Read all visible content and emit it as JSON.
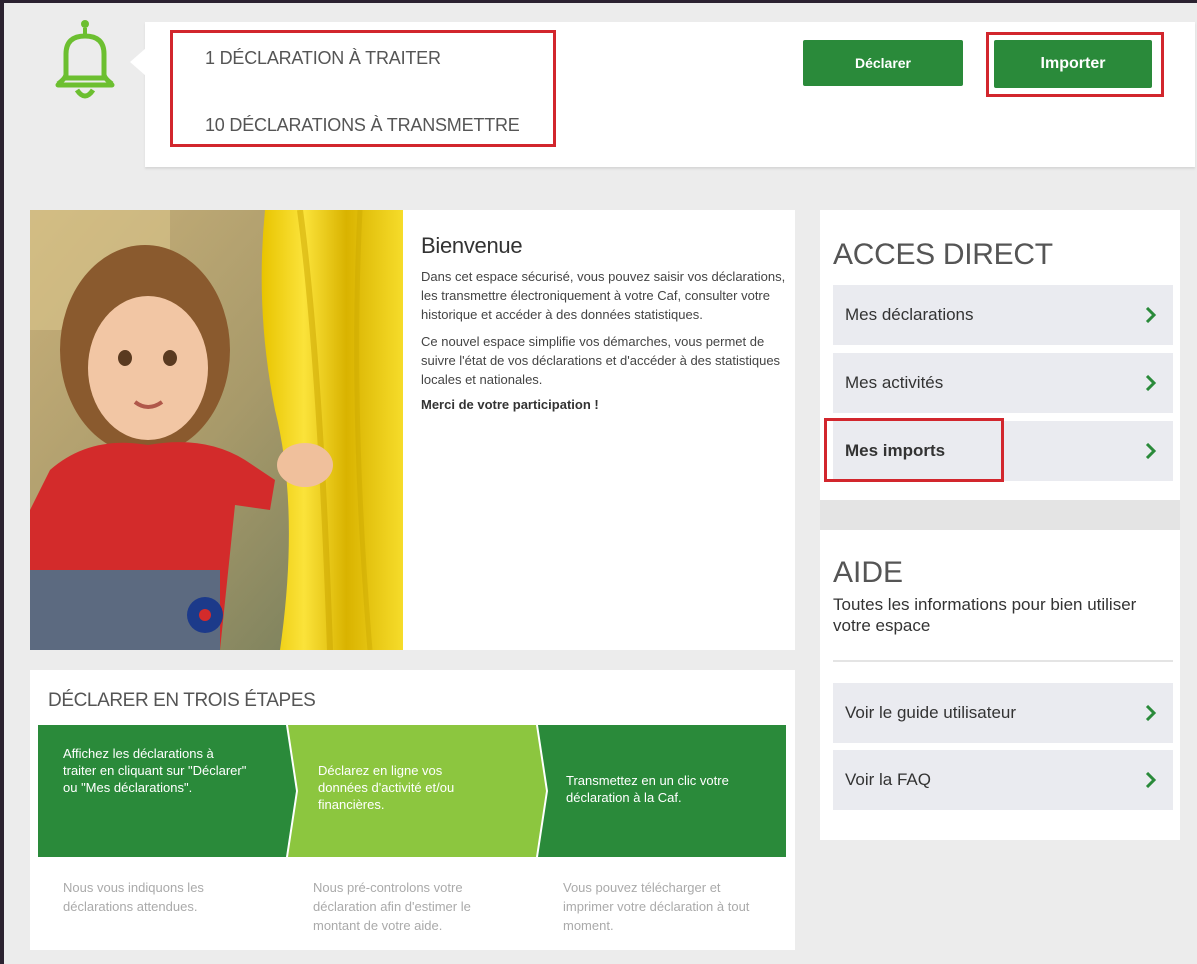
{
  "notifications": {
    "line1": "1 DÉCLARATION À TRAITER",
    "line2": "10 DÉCLARATIONS À TRANSMETTRE"
  },
  "toolbar": {
    "declarer_label": "Déclarer",
    "importer_label": "Importer"
  },
  "welcome": {
    "title": "Bienvenue",
    "paragraph1": "Dans cet espace sécurisé, vous pouvez saisir vos déclarations, les transmettre électroniquement à votre Caf, consulter votre historique et accéder à des données statistiques.",
    "paragraph2": "Ce nouvel espace simplifie vos démarches, vous permet de suivre l'état de vos déclarations et d'accéder à des statistiques locales et nationales.",
    "thanks": "Merci de votre participation !"
  },
  "steps": {
    "title": "DÉCLARER EN TROIS ÉTAPES",
    "items": [
      {
        "text": "Affichez les déclarations à traiter en cliquant sur \"Déclarer\" ou \"Mes déclarations\".",
        "desc": "Nous vous indiquons les déclarations attendues."
      },
      {
        "text": "Déclarez en ligne vos données d'activité et/ou financières.",
        "desc": "Nous pré-controlons votre déclaration afin d'estimer le montant de votre aide."
      },
      {
        "text": "Transmettez en un clic votre déclaration à la Caf.",
        "desc": "Vous pouvez télécharger et imprimer votre déclaration à tout moment."
      }
    ]
  },
  "acces_direct": {
    "title": "ACCES DIRECT",
    "items": [
      {
        "label": "Mes déclarations"
      },
      {
        "label": "Mes activités"
      },
      {
        "label": "Mes imports"
      }
    ]
  },
  "aide": {
    "title": "AIDE",
    "subtitle": "Toutes les informations pour bien utiliser votre espace",
    "items": [
      {
        "label": "Voir le guide utilisateur"
      },
      {
        "label": "Voir la FAQ"
      }
    ]
  },
  "colors": {
    "brand_green": "#2a8a3a",
    "light_green": "#8cc63f",
    "highlight_red": "#d2262d"
  },
  "icons": {
    "bell": "bell-icon",
    "chevron": "chevron-right-icon"
  }
}
